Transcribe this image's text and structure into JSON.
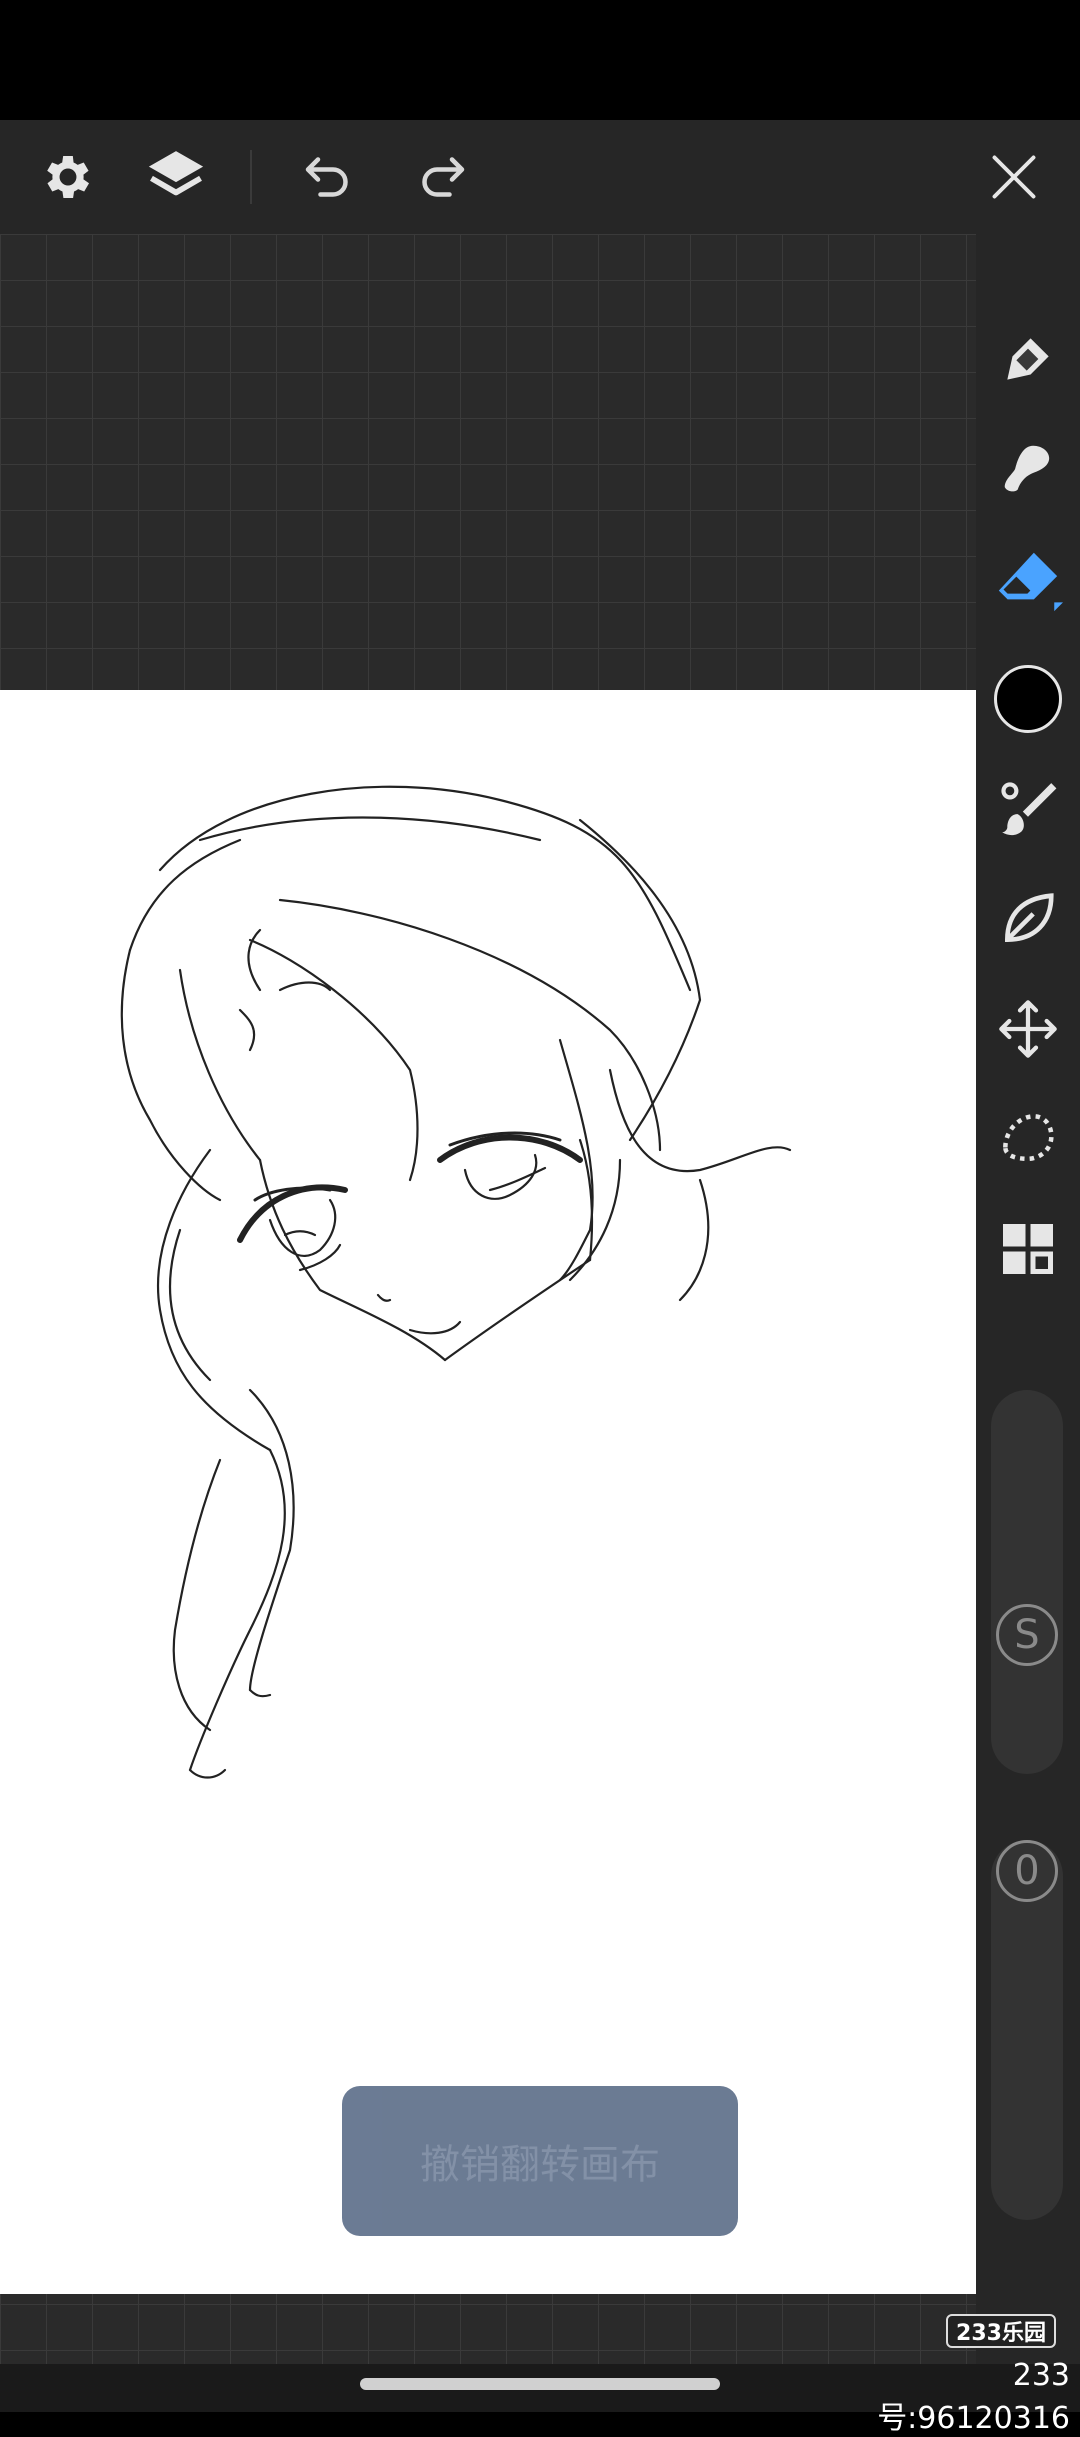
{
  "topbar": {
    "icons": [
      "gear-icon",
      "layers-icon",
      "undo-icon",
      "redo-icon",
      "close-icon"
    ]
  },
  "sidebar": {
    "tools": [
      "pen-icon",
      "smudge-icon",
      "eraser-icon",
      "color-swatch",
      "brush-icon",
      "liquify-icon",
      "move-icon",
      "lasso-icon",
      "grid-icon"
    ],
    "active_tool": "eraser-icon",
    "active_color": "#4aa3ff",
    "current_color": "#000000",
    "size_label": "S",
    "opacity_label": "0"
  },
  "toast": {
    "text": "撤销翻转画布"
  },
  "watermark": {
    "logo": "233乐园",
    "id_text": "233号:96120316"
  }
}
